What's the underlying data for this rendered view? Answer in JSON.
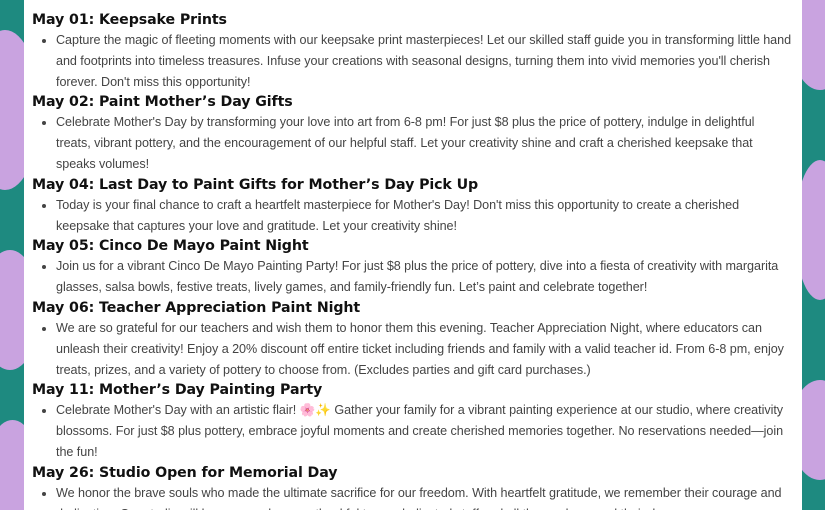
{
  "events": [
    {
      "title": "May 01: Keepsake Prints",
      "description": "Capture the magic of fleeting moments with our keepsake print masterpieces! Let our skilled staff guide you in transforming little hand and footprints into timeless treasures. Infuse your creations with seasonal designs, turning them into vivid memories you'll cherish forever. Don't miss this opportunity!"
    },
    {
      "title": "May 02: Paint Mother’s Day Gifts",
      "description": "Celebrate Mother's Day by transforming your love into art from 6-8 pm! For just $8 plus the price of pottery, indulge in delightful treats, vibrant pottery, and the encouragement of our helpful staff. Let your creativity shine and craft a cherished keepsake that speaks volumes!"
    },
    {
      "title": "May 04: Last Day to Paint Gifts for Mother’s Day Pick Up",
      "description": "Today is your final chance to craft a heartfelt masterpiece for Mother's Day! Don't miss this opportunity to create a cherished keepsake that captures your love and gratitude. Let your creativity shine!"
    },
    {
      "title": "May 05: Cinco De Mayo Paint Night",
      "description": "Join us for a vibrant Cinco De Mayo Painting Party! For just $8 plus the price of pottery, dive into a fiesta of creativity with margarita glasses, salsa bowls, festive treats, lively games, and family-friendly fun. Let’s paint and celebrate together!"
    },
    {
      "title": "May 06: Teacher Appreciation Paint Night",
      "description": "We are so grateful for our teachers and wish them to honor them this evening.  Teacher Appreciation Night, where educators can unleash their creativity! Enjoy a 20% discount off entire ticket  including friends and family with a valid teacher id. From 6-8 pm, enjoy treats, prizes, and a variety of pottery to choose from.  (Excludes parties and gift card purchases.)"
    },
    {
      "title": "May 11: Mother’s Day Painting Party",
      "description": "Celebrate Mother's Day with an artistic flair! 🌸✨ Gather your family for a vibrant painting experience at our studio, where creativity blossoms. For just $8 plus pottery, embrace joyful moments and create cherished memories together. No reservations needed—join the fun!"
    },
    {
      "title": "May 26: Studio Open for Memorial Day",
      "description": "We honor the brave souls who made the ultimate sacrifice for our freedom. With heartfelt gratitude, we remember their courage and dedication. Our studio will be open and we are thankful to our dedicated staff and all those who spend their day"
    }
  ]
}
